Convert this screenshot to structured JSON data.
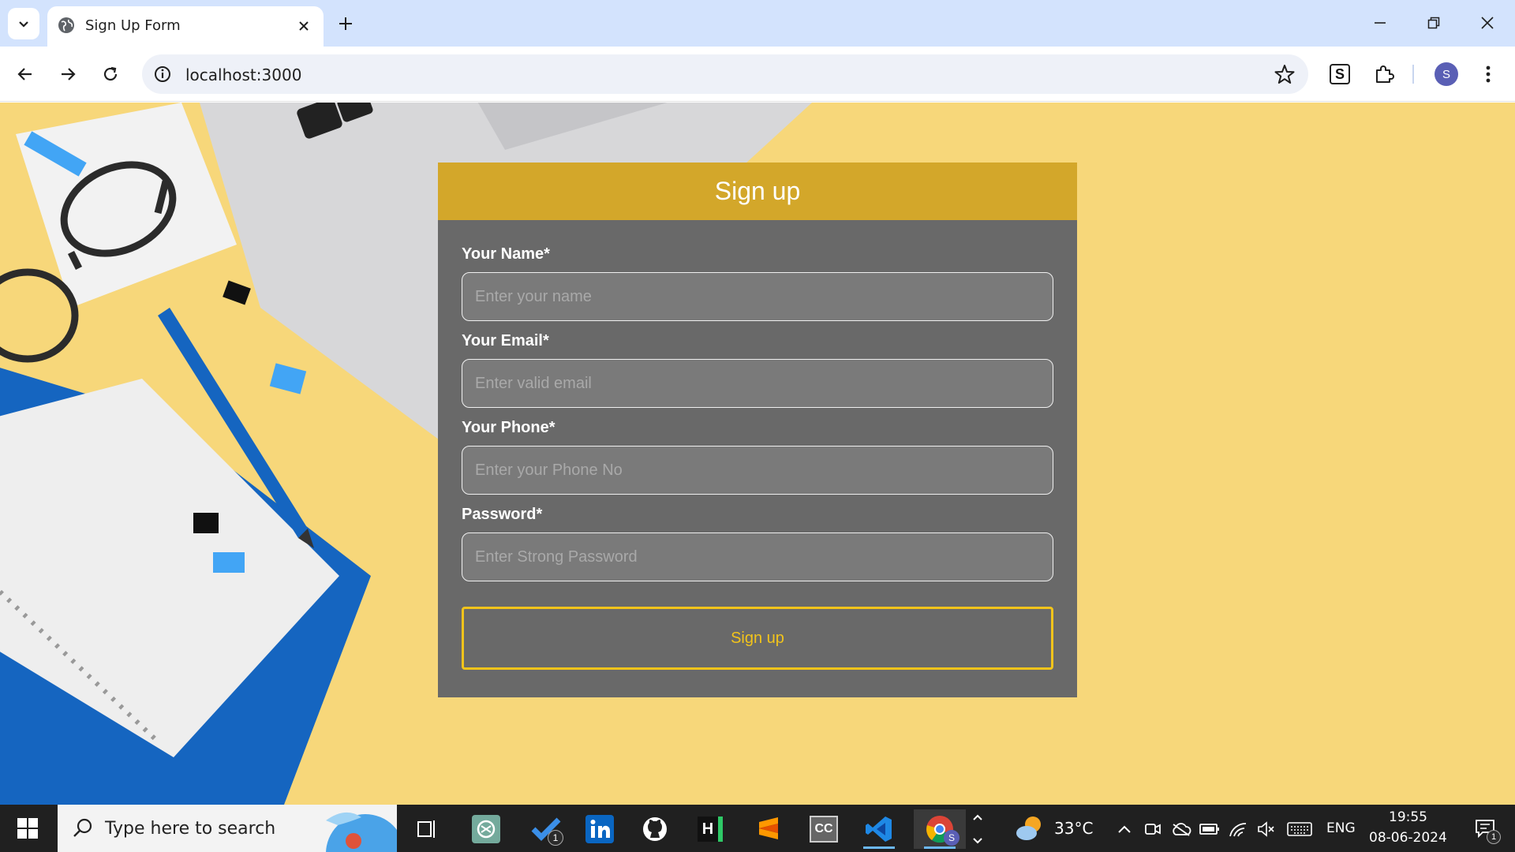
{
  "browser": {
    "tab_title": "Sign Up Form",
    "url": "localhost:3000",
    "profile_initial": "S",
    "extension_letter": "S"
  },
  "form": {
    "title": "Sign up",
    "fields": [
      {
        "label": "Your Name*",
        "placeholder": "Enter your name",
        "value": ""
      },
      {
        "label": "Your Email*",
        "placeholder": "Enter valid email",
        "value": ""
      },
      {
        "label": "Your Phone*",
        "placeholder": "Enter your Phone No",
        "value": ""
      },
      {
        "label": "Password*",
        "placeholder": "Enter Strong Password",
        "value": ""
      }
    ],
    "submit_label": "Sign up"
  },
  "taskbar": {
    "search_placeholder": "Type here to search",
    "todo_badge": "1",
    "temperature": "33°C",
    "language": "ENG",
    "time": "19:55",
    "date": "08-06-2024",
    "notification_badge": "1",
    "vscode_label": "VS",
    "codechef_label": "CC",
    "hackerrank_label": "H",
    "chrome_profile_badge": "S"
  },
  "colors": {
    "page_background": "#f7d77a",
    "form_header": "#d3a72a",
    "form_body": "#696969",
    "button_accent": "#f2c41b",
    "tabbar": "#d3e3fd"
  }
}
